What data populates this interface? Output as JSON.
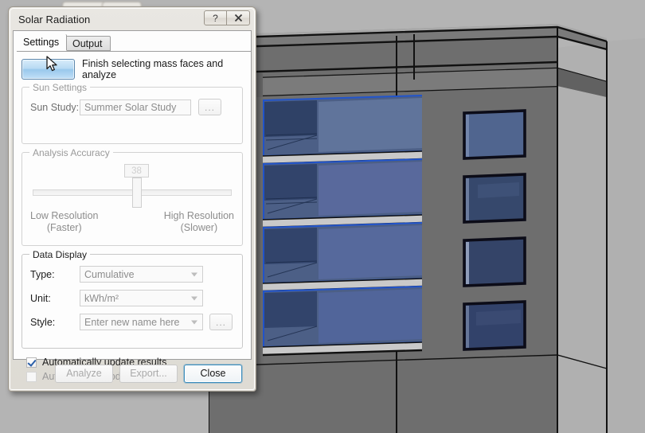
{
  "dialog": {
    "title": "Solar Radiation",
    "help_button": "?",
    "close_button": "X",
    "tabs": [
      {
        "label": "Settings",
        "active": true
      },
      {
        "label": "Output",
        "active": false
      }
    ],
    "action": {
      "button_label": "",
      "instruction": "Finish selecting mass faces and analyze"
    },
    "sun_settings": {
      "group_label": "Sun Settings",
      "sun_study_label": "Sun Study:",
      "sun_study_value": "Summer Solar Study",
      "browse_label": "..."
    },
    "analysis_accuracy": {
      "group_label": "Analysis Accuracy",
      "slider_value": "38",
      "slider_min_value": 0,
      "slider_max_value": 100,
      "low_label_line1": "Low  Resolution",
      "low_label_line2": "(Faster)",
      "high_label_line1": "High Resolution",
      "high_label_line2": "(Slower)"
    },
    "data_display": {
      "group_label": "Data Display",
      "type_label": "Type:",
      "type_value": "Cumulative",
      "unit_label": "Unit:",
      "unit_value": "kWh/m²",
      "style_label": "Style:",
      "style_value": "Enter new name here",
      "style_browse_label": "..."
    },
    "checkboxes": [
      {
        "label": "Automatically update results",
        "checked": true,
        "enabled": true
      },
      {
        "label": "Automatically update export",
        "checked": false,
        "enabled": false
      }
    ],
    "footer_buttons": [
      {
        "label": "Analyze",
        "enabled": false,
        "default": false
      },
      {
        "label": "Export...",
        "enabled": false,
        "default": false
      },
      {
        "label": "Close",
        "enabled": true,
        "default": true
      }
    ]
  },
  "viewport": {
    "name": "revit-3d-model-view",
    "background_color": "#b4b4b4",
    "facade_color": "#6e6e6e",
    "facade_light_color": "#b0b0b0",
    "slab_color": "#9a9a9a",
    "glass_color": "#3f5478",
    "glass_highlight_color": "#5c7099",
    "glass_edge_color": "#2255cc"
  },
  "colors": {
    "accent_blue": "#3c8dbc",
    "dialog_bg": "#e6e4de",
    "client_bg": "#fdfdfd",
    "checkmark": "#2a5fa8"
  }
}
